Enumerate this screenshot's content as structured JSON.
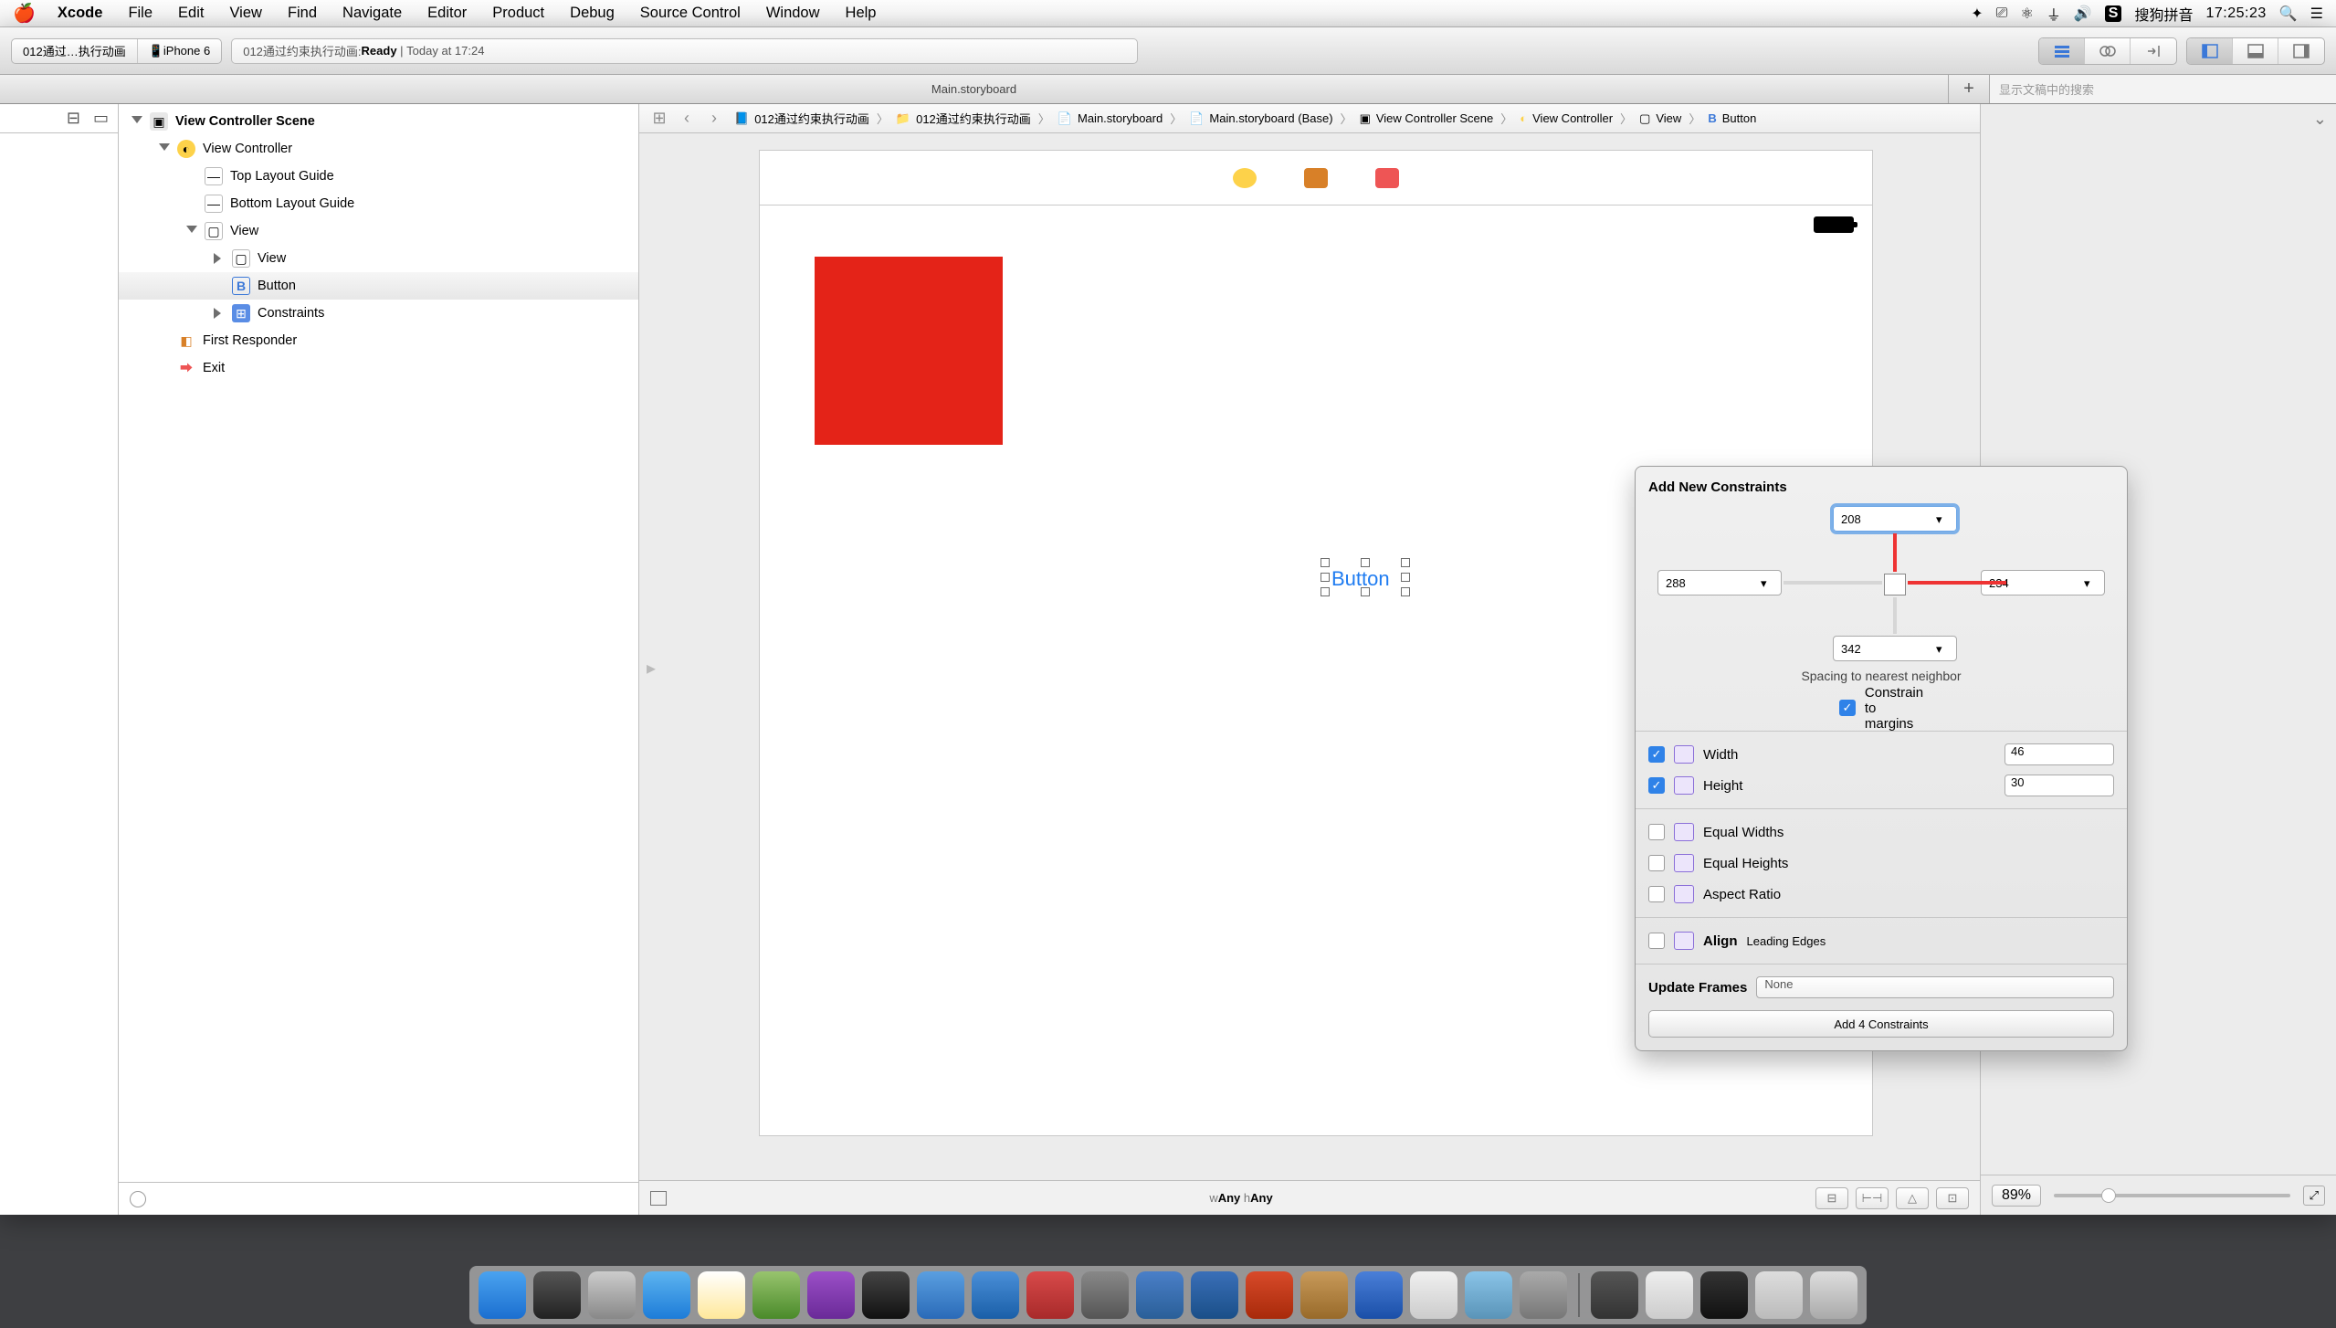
{
  "menubar": {
    "app": "Xcode",
    "items": [
      "File",
      "Edit",
      "View",
      "Find",
      "Navigate",
      "Editor",
      "Product",
      "Debug",
      "Source Control",
      "Window",
      "Help"
    ],
    "ime": "搜狗拼音",
    "clock": "17:25:23"
  },
  "toolbar": {
    "scheme_target": "012通过…执行动画",
    "scheme_device": "iPhone 6",
    "status_prefix": "012通过约束执行动画: ",
    "status_state": "Ready",
    "status_time": "Today at 17:24"
  },
  "tabbar": {
    "tab": "Main.storyboard",
    "search_placeholder": "显示文稿中的搜索"
  },
  "jumpbar": {
    "items": [
      {
        "icon": "proj",
        "label": "012通过约束执行动画"
      },
      {
        "icon": "folder",
        "label": "012通过约束执行动画"
      },
      {
        "icon": "storyboard",
        "label": "Main.storyboard"
      },
      {
        "icon": "storyboard",
        "label": "Main.storyboard (Base)"
      },
      {
        "icon": "scene",
        "label": "View Controller Scene"
      },
      {
        "icon": "vc",
        "label": "View Controller"
      },
      {
        "icon": "view",
        "label": "View"
      },
      {
        "icon": "button",
        "label": "Button"
      }
    ]
  },
  "outline": {
    "root": "View Controller Scene",
    "vc": "View Controller",
    "top_guide": "Top Layout Guide",
    "bottom_guide": "Bottom Layout Guide",
    "view": "View",
    "subview": "View",
    "button": "Button",
    "constraints": "Constraints",
    "first_responder": "First Responder",
    "exit": "Exit"
  },
  "canvas": {
    "button_text": "Button",
    "size_w": "Any",
    "size_h": "Any"
  },
  "popover": {
    "title": "Add New Constraints",
    "top": "208",
    "leading": "288",
    "trailing": "234",
    "bottom": "342",
    "hint": "Spacing to nearest neighbor",
    "constrain_margins": "Constrain to margins",
    "width_label": "Width",
    "width_val": "46",
    "height_label": "Height",
    "height_val": "30",
    "equal_w": "Equal Widths",
    "equal_h": "Equal Heights",
    "aspect": "Aspect Ratio",
    "align": "Align",
    "align_val": "Leading Edges",
    "update": "Update Frames",
    "update_val": "None",
    "submit": "Add 4 Constraints"
  },
  "rightpane": {
    "zoom": "89%"
  }
}
